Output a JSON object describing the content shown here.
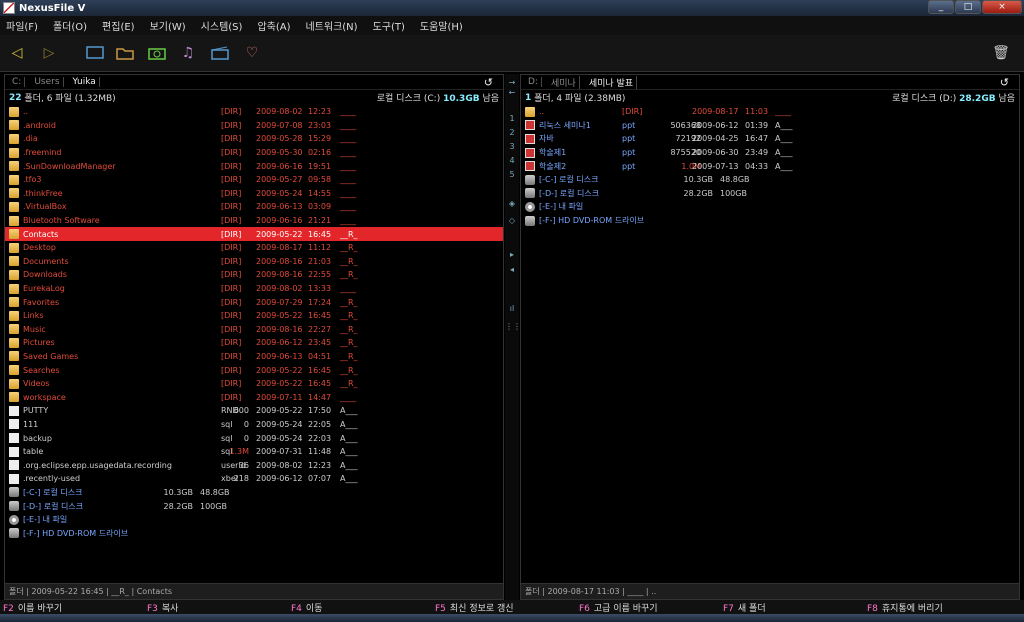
{
  "window": {
    "title": "NexusFile V",
    "min_label": "_",
    "max_label": "□",
    "close_label": "×"
  },
  "menu": [
    "파일(F)",
    "폴더(O)",
    "편집(E)",
    "보기(W)",
    "시스템(S)",
    "압축(A)",
    "네트워크(N)",
    "도구(T)",
    "도움말(H)"
  ],
  "toolbar": {
    "back_icon": "◁",
    "forward_icon": "▷",
    "trash_icon": "🗑"
  },
  "left": {
    "path": [
      "C:",
      "Users",
      "Yuika"
    ],
    "refresh_icon": "↺",
    "summary_count": "22",
    "summary_text": "폴더, 6 파일 (1.32MB)",
    "drive_label": "로컬 디스크 (C:)",
    "drive_free": "10.3GB",
    "drive_suffix": "남음",
    "status": "폴더 | 2009-05-22 16:45 | __R_ | Contacts",
    "dirs": [
      [
        "..",
        "[DIR]",
        "2009-08-02",
        "12:23",
        "____"
      ],
      [
        ".android",
        "[DIR]",
        "2009-07-08",
        "23:03",
        "____"
      ],
      [
        ".dia",
        "[DIR]",
        "2009-05-28",
        "15:29",
        "____"
      ],
      [
        ".freemind",
        "[DIR]",
        "2009-05-30",
        "02:16",
        "____"
      ],
      [
        ".SunDownloadManager",
        "[DIR]",
        "2009-06-16",
        "19:51",
        "____"
      ],
      [
        ".tfo3",
        "[DIR]",
        "2009-05-27",
        "09:58",
        "____"
      ],
      [
        ".thinkFree",
        "[DIR]",
        "2009-05-24",
        "14:55",
        "____"
      ],
      [
        ".VirtualBox",
        "[DIR]",
        "2009-06-13",
        "03:09",
        "____"
      ],
      [
        "Bluetooth Software",
        "[DIR]",
        "2009-06-16",
        "21:21",
        "____"
      ],
      [
        "Contacts",
        "[DIR]",
        "2009-05-22",
        "16:45",
        "__R_"
      ],
      [
        "Desktop",
        "[DIR]",
        "2009-08-17",
        "11:12",
        "__R_"
      ],
      [
        "Documents",
        "[DIR]",
        "2009-08-16",
        "21:03",
        "__R_"
      ],
      [
        "Downloads",
        "[DIR]",
        "2009-08-16",
        "22:55",
        "__R_"
      ],
      [
        "EurekaLog",
        "[DIR]",
        "2009-08-02",
        "13:33",
        "____"
      ],
      [
        "Favorites",
        "[DIR]",
        "2009-07-29",
        "17:24",
        "__R_"
      ],
      [
        "Links",
        "[DIR]",
        "2009-05-22",
        "16:45",
        "__R_"
      ],
      [
        "Music",
        "[DIR]",
        "2009-08-16",
        "22:27",
        "__R_"
      ],
      [
        "Pictures",
        "[DIR]",
        "2009-06-12",
        "23:45",
        "__R_"
      ],
      [
        "Saved Games",
        "[DIR]",
        "2009-06-13",
        "04:51",
        "__R_"
      ],
      [
        "Searches",
        "[DIR]",
        "2009-05-22",
        "16:45",
        "__R_"
      ],
      [
        "Videos",
        "[DIR]",
        "2009-05-22",
        "16:45",
        "__R_"
      ],
      [
        "workspace",
        "[DIR]",
        "2009-07-11",
        "14:47",
        "____"
      ]
    ],
    "files": [
      [
        "PUTTY",
        "RND",
        "600",
        "2009-05-22",
        "17:50",
        "A___"
      ],
      [
        "111",
        "sql",
        "0",
        "2009-05-24",
        "22:05",
        "A___"
      ],
      [
        "backup",
        "sql",
        "0",
        "2009-05-24",
        "22:03",
        "A___"
      ],
      [
        "table",
        "sql",
        "1.3M",
        "2009-07-31",
        "11:48",
        "A___"
      ],
      [
        ".org.eclipse.epp.usagedata.recording",
        "userId",
        "36",
        "2009-08-02",
        "12:23",
        "A___"
      ],
      [
        ".recently-used",
        "xbel",
        "218",
        "2009-06-12",
        "07:07",
        "A___"
      ]
    ],
    "drives": [
      [
        "[-C-] 로컬 디스크",
        "10.3GB",
        "48.8GB"
      ],
      [
        "[-D-] 로컬 디스크",
        "28.2GB",
        "100GB"
      ],
      [
        "[-E-] 내 파일",
        "",
        ""
      ],
      [
        "[-F-] HD DVD-ROM 드라이브",
        "",
        ""
      ]
    ]
  },
  "right": {
    "path": [
      "D:",
      "세미나",
      "세미나 발표"
    ],
    "refresh_icon": "↺",
    "summary_count": "1",
    "summary_text": "폴더, 4 파일 (2.38MB)",
    "drive_label": "로컬 디스크 (D:)",
    "drive_free": "28.2GB",
    "drive_suffix": "남음",
    "status": "폴더 | 2009-08-17 11:03 | ____ | ..",
    "dirs": [
      [
        "..",
        "[DIR]",
        "2009-08-17",
        "11:03",
        "____"
      ]
    ],
    "files": [
      [
        "리눅스 세미나1",
        "ppt",
        "506368",
        "2009-06-12",
        "01:39",
        "A___"
      ],
      [
        "자바",
        "ppt",
        "72192",
        "2009-04-25",
        "16:47",
        "A___"
      ],
      [
        "학술제1",
        "ppt",
        "875520",
        "2009-06-30",
        "23:49",
        "A___"
      ],
      [
        "학술제2",
        "ppt",
        "1.0M",
        "2009-07-13",
        "04:33",
        "A___"
      ]
    ],
    "drives": [
      [
        "[-C-] 로컬 디스크",
        "10.3GB",
        "48.8GB"
      ],
      [
        "[-D-] 로컬 디스크",
        "28.2GB",
        "100GB"
      ],
      [
        "[-E-] 내 파일",
        "",
        ""
      ],
      [
        "[-F-] HD DVD-ROM 드라이브",
        "",
        ""
      ]
    ]
  },
  "midbar": [
    "→",
    "←",
    "1",
    "2",
    "3",
    "4",
    "5",
    "◈",
    "◇",
    "▸",
    "◂",
    "ıl",
    "⋮⋮"
  ],
  "fkeys": [
    [
      "F2",
      "이름 바꾸기"
    ],
    [
      "F3",
      "복사"
    ],
    [
      "F4",
      "이동"
    ],
    [
      "F5",
      "최신 정보로 갱신"
    ],
    [
      "F6",
      "고급 이름 바꾸기"
    ],
    [
      "F7",
      "새 폴더"
    ],
    [
      "F8",
      "휴지통에 버리기"
    ]
  ]
}
